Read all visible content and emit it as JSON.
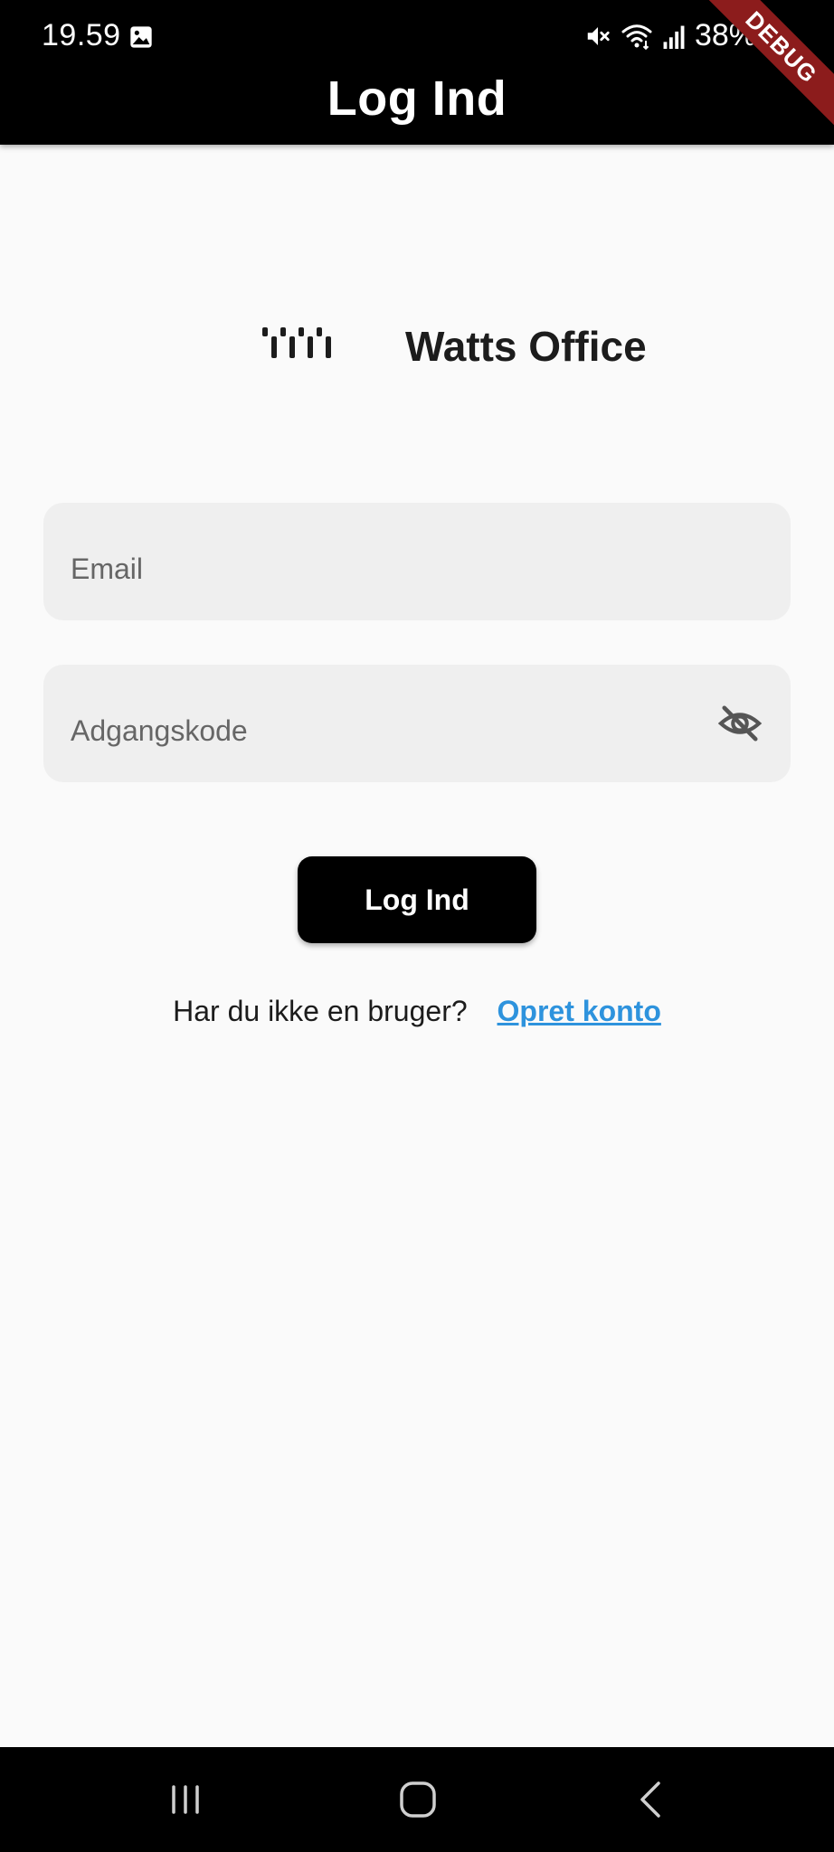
{
  "status_bar": {
    "time": "19.59",
    "battery": "38%",
    "icons": [
      "gallery-icon",
      "mute-icon",
      "wifi-icon",
      "signal-icon"
    ]
  },
  "app_bar": {
    "title": "Log Ind"
  },
  "debug_banner": {
    "label": "DEBUG"
  },
  "logo": {
    "icon": "watts-logo-icon",
    "text": "Watts Office"
  },
  "form": {
    "email": {
      "placeholder": "Email",
      "value": ""
    },
    "password": {
      "placeholder": "Adgangskode",
      "value": "",
      "toggle_icon": "visibility-off-icon"
    },
    "submit_label": "Log Ind"
  },
  "signup": {
    "prompt": "Har du ikke en bruger?",
    "link_label": "Opret konto"
  },
  "nav_bar": {
    "buttons": [
      "recents-icon",
      "home-icon",
      "back-icon"
    ]
  },
  "colors": {
    "app_bar": "#000000",
    "background": "#fafafa",
    "field": "#efefef",
    "button": "#000000",
    "link": "#2e93dd",
    "debug_banner": "#8c1c1c"
  }
}
